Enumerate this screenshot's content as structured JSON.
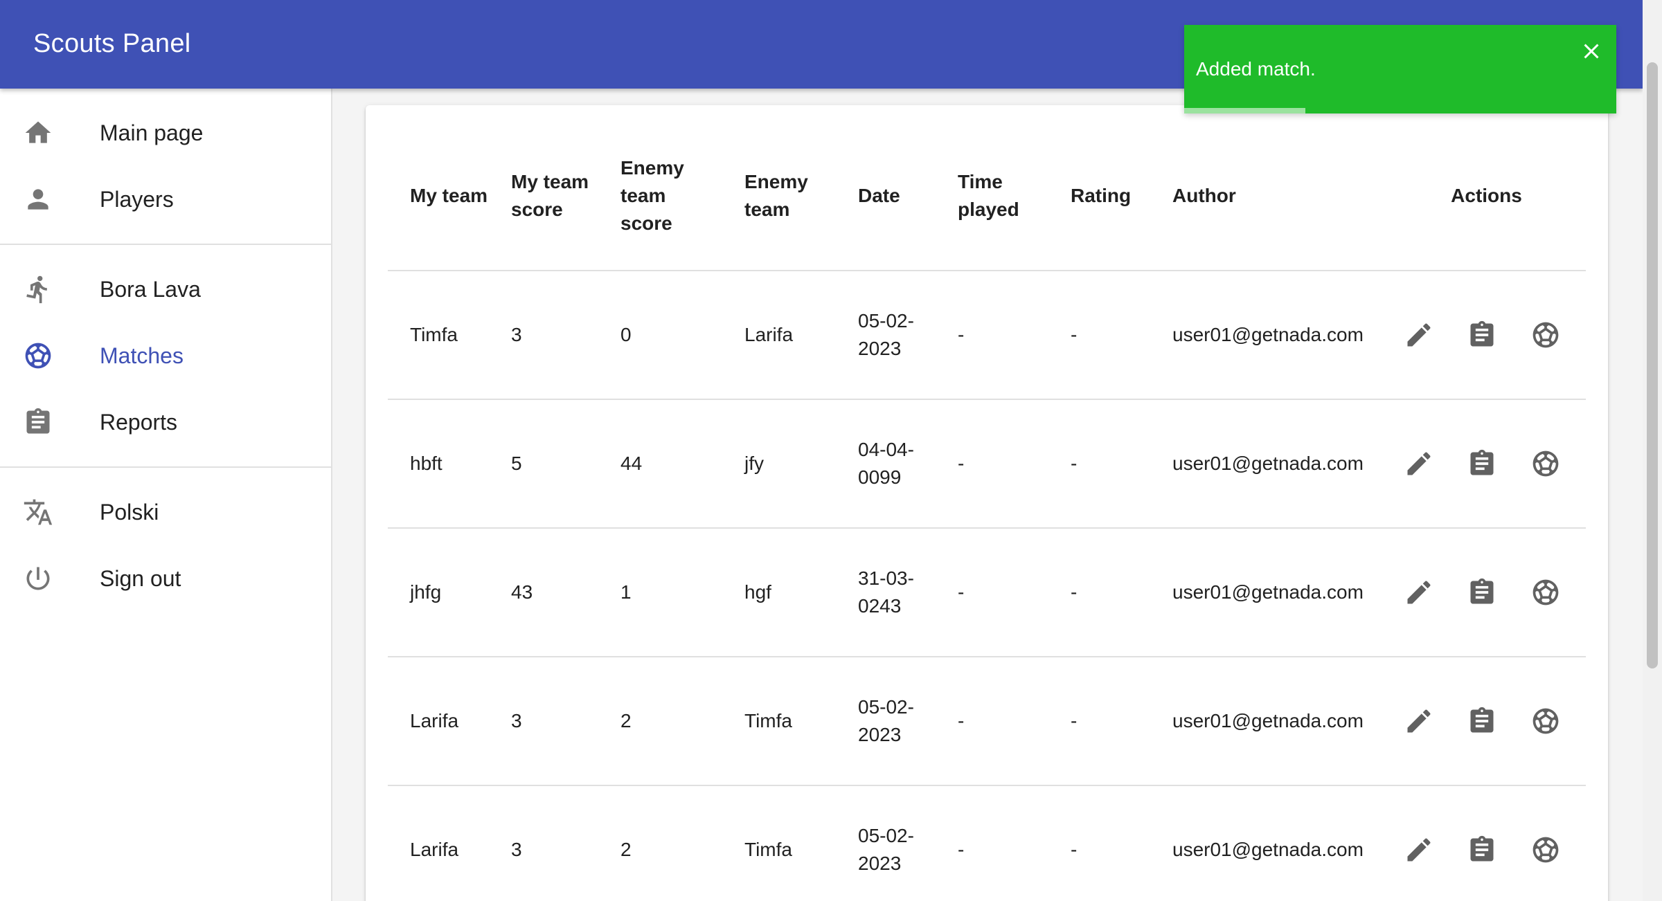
{
  "app": {
    "title": "Scouts Panel"
  },
  "nav": {
    "main": [
      {
        "label": "Main page",
        "icon": "home-icon",
        "name": "sidebar-item-main-page"
      },
      {
        "label": "Players",
        "icon": "person-icon",
        "name": "sidebar-item-players"
      }
    ],
    "player": [
      {
        "label": "Bora Lava",
        "icon": "run-icon",
        "name": "sidebar-item-bora-lava"
      },
      {
        "label": "Matches",
        "icon": "soccer-ball-icon",
        "name": "sidebar-item-matches",
        "active": true
      },
      {
        "label": "Reports",
        "icon": "assignment-icon",
        "name": "sidebar-item-reports"
      }
    ],
    "settings": [
      {
        "label": "Polski",
        "icon": "translate-icon",
        "name": "sidebar-item-language"
      },
      {
        "label": "Sign out",
        "icon": "power-icon",
        "name": "sidebar-item-sign-out"
      }
    ]
  },
  "table": {
    "headers": {
      "my_team": "My team",
      "my_team_score": "My team score",
      "enemy_team_score": "Enemy team score",
      "enemy_team": "Enemy team",
      "date": "Date",
      "time_played": "Time played",
      "rating": "Rating",
      "author": "Author",
      "actions": "Actions"
    },
    "rows": [
      {
        "my_team": "Timfa",
        "my_team_score": "3",
        "enemy_team_score": "0",
        "enemy_team": "Larifa",
        "date": "05-02-2023",
        "time_played": "-",
        "rating": "-",
        "author": "user01@getnada.com"
      },
      {
        "my_team": "hbft",
        "my_team_score": "5",
        "enemy_team_score": "44",
        "enemy_team": "jfy",
        "date": "04-04-0099",
        "time_played": "-",
        "rating": "-",
        "author": "user01@getnada.com"
      },
      {
        "my_team": "jhfg",
        "my_team_score": "43",
        "enemy_team_score": "1",
        "enemy_team": "hgf",
        "date": "31-03-0243",
        "time_played": "-",
        "rating": "-",
        "author": "user01@getnada.com"
      },
      {
        "my_team": "Larifa",
        "my_team_score": "3",
        "enemy_team_score": "2",
        "enemy_team": "Timfa",
        "date": "05-02-2023",
        "time_played": "-",
        "rating": "-",
        "author": "user01@getnada.com"
      },
      {
        "my_team": "Larifa",
        "my_team_score": "3",
        "enemy_team_score": "2",
        "enemy_team": "Timfa",
        "date": "05-02-2023",
        "time_played": "-",
        "rating": "-",
        "author": "user01@getnada.com"
      }
    ],
    "row_actions": [
      {
        "icon": "pencil-icon",
        "name": "edit-match-button"
      },
      {
        "icon": "assignment-icon",
        "name": "match-reports-button"
      },
      {
        "icon": "soccer-ball-icon",
        "name": "match-details-button"
      }
    ]
  },
  "snackbar": {
    "message": "Added match.",
    "close_icon": "close-icon",
    "progress": 0.28,
    "color": "#1fbb2a"
  },
  "colors": {
    "primary": "#3f51b5",
    "icon_gray": "#616161"
  }
}
